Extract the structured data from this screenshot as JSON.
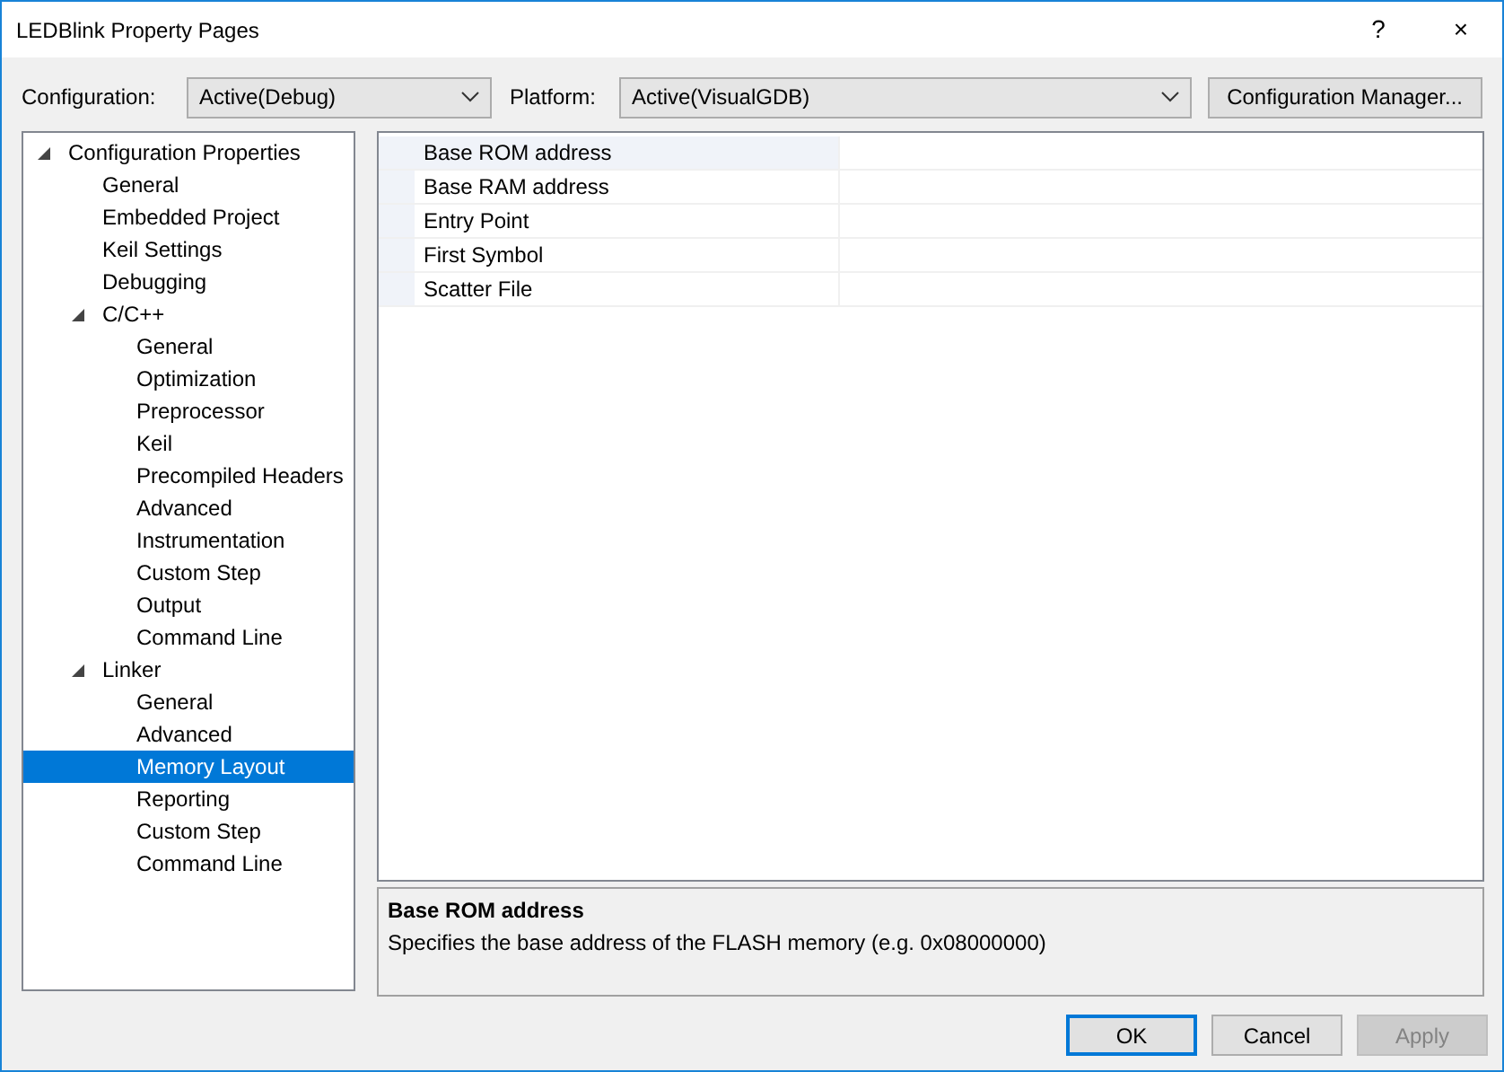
{
  "window": {
    "title": "LEDBlink Property Pages",
    "buttons": [
      "?",
      "×"
    ]
  },
  "toolbar": {
    "configuration_label": "Configuration:",
    "configuration": "Active(Debug)",
    "platform_label": "Platform:",
    "platform": "Active(VisualGDB)",
    "manager_button": "Configuration Manager..."
  },
  "tree": [
    {
      "label": "Configuration Properties",
      "expanded": true,
      "selected": false,
      "children": [
        {
          "label": "General",
          "selected": false
        },
        {
          "label": "Embedded Project",
          "selected": false
        },
        {
          "label": "Keil Settings",
          "selected": false
        },
        {
          "label": "Debugging",
          "selected": false
        },
        {
          "label": "C/C++",
          "expanded": true,
          "selected": false,
          "children": [
            {
              "label": "General",
              "selected": false
            },
            {
              "label": "Optimization",
              "selected": false
            },
            {
              "label": "Preprocessor",
              "selected": false
            },
            {
              "label": "Keil",
              "selected": false
            },
            {
              "label": "Precompiled Headers",
              "selected": false
            },
            {
              "label": "Advanced",
              "selected": false
            },
            {
              "label": "Instrumentation",
              "selected": false
            },
            {
              "label": "Custom Step",
              "selected": false
            },
            {
              "label": "Output",
              "selected": false
            },
            {
              "label": "Command Line",
              "selected": false
            }
          ]
        },
        {
          "label": "Linker",
          "expanded": true,
          "selected": false,
          "children": [
            {
              "label": "General",
              "selected": false
            },
            {
              "label": "Advanced",
              "selected": false
            },
            {
              "label": "Memory Layout",
              "selected": true
            },
            {
              "label": "Reporting",
              "selected": false
            },
            {
              "label": "Custom Step",
              "selected": false
            },
            {
              "label": "Command Line",
              "selected": false
            }
          ]
        }
      ]
    }
  ],
  "properties": [
    {
      "name": "Base ROM address",
      "selected": true
    },
    {
      "name": "Base RAM address",
      "selected": false
    },
    {
      "name": "Entry Point",
      "selected": false
    },
    {
      "name": "First Symbol",
      "selected": false
    },
    {
      "name": "Scatter File",
      "selected": false
    }
  ],
  "description": {
    "title": "Base ROM address",
    "text": "Specifies the base address of the FLASH memory (e.g. 0x08000000)"
  },
  "buttons": [
    {
      "label": "OK",
      "default": true,
      "disabled": false
    },
    {
      "label": "Cancel",
      "default": false,
      "disabled": false
    },
    {
      "label": "Apply",
      "default": false,
      "disabled": true
    }
  ]
}
